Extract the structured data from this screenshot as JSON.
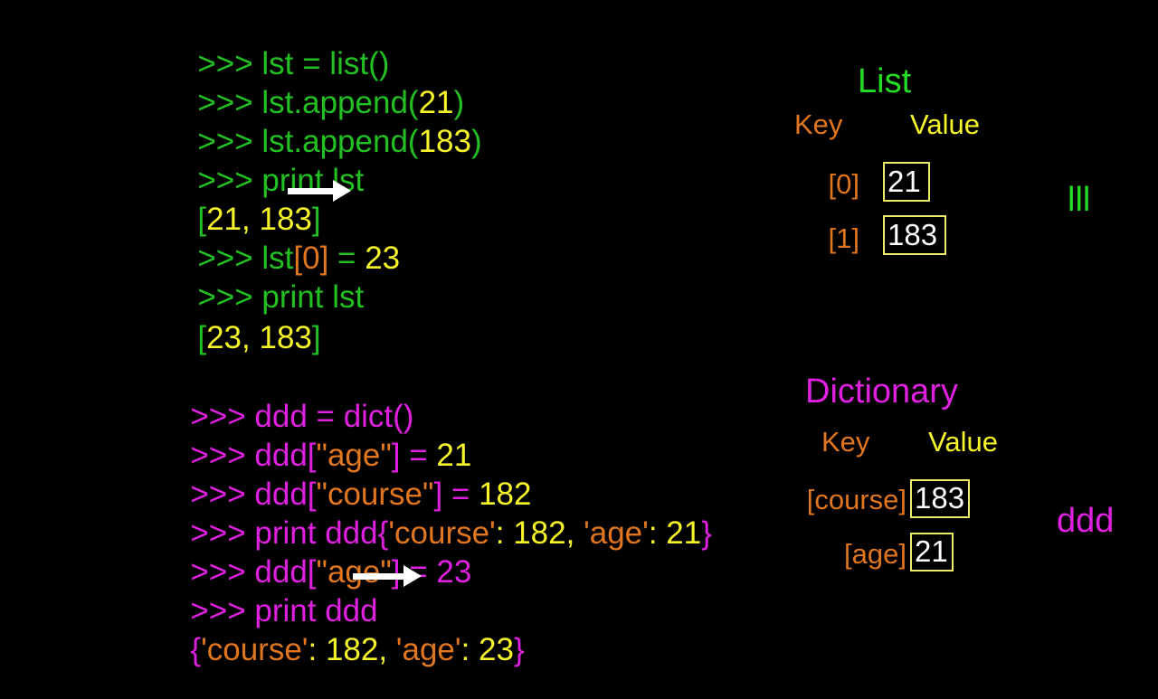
{
  "slide": {
    "background_color": "#000000",
    "colors": {
      "green": "#22c022",
      "green_bright": "#22dd22",
      "yellow": "#f5f52a",
      "orange": "#e0761f",
      "magenta": "#e020e0",
      "white": "#ffffff",
      "box_border": "#eeee66"
    }
  },
  "list_console": {
    "lines": [
      {
        "prompt": ">>> ",
        "code": "lst = list()",
        "number": ""
      },
      {
        "prompt": ">>> ",
        "code": "lst.append(",
        "number": "21",
        "close": ")"
      },
      {
        "prompt": ">>> ",
        "code": "lst.append(",
        "number": "183",
        "close": ")"
      },
      {
        "prompt": ">>> ",
        "code": "print lst",
        "number": ""
      },
      {
        "output_open": "[",
        "out_a": "21",
        "out_sep": ", ",
        "out_b": "183",
        "output_close": "]"
      },
      {
        "prompt": ">>> ",
        "code": "lst",
        "index": "[0]",
        "eq": " = ",
        "number": "23"
      },
      {
        "prompt": ">>> ",
        "code": "print lst",
        "number": ""
      },
      {
        "output_open": "[",
        "out_a": "23",
        "out_sep": ", ",
        "out_b": "183",
        "output_close": "]"
      }
    ],
    "l1_prompt": ">>> ",
    "l1_code": "lst = list()",
    "l2_prompt": ">>> ",
    "l2_code": "lst.append(",
    "l2_num": "21",
    "l2_close": ")",
    "l3_prompt": ">>> ",
    "l3_code": "lst.append(",
    "l3_num": "183",
    "l3_close": ")",
    "l4_prompt": ">>> ",
    "l4_code": "print lst",
    "l5_open": "[",
    "l5_a": "21",
    "l5_sep": ", ",
    "l5_b": "183",
    "l5_close": "]",
    "l6_prompt": ">>> ",
    "l6_code": "lst",
    "l6_index": "[0]",
    "l6_eq": " = ",
    "l6_num": "23",
    "l7_prompt": ">>> ",
    "l7_code": "print lst",
    "l8_open": "[",
    "l8_a": "23",
    "l8_sep": ", ",
    "l8_b": "183",
    "l8_close": "]"
  },
  "dict_console": {
    "d1_prompt": ">>> ",
    "d1_code": "ddd = dict()",
    "d2_prompt": ">>> ",
    "d2_code": "ddd[",
    "d2_key": "\"age\"",
    "d2_bracket": "]",
    "d2_eq": " = ",
    "d2_num": "21",
    "d3_prompt": ">>> ",
    "d3_code": "ddd[",
    "d3_key": "\"course\"",
    "d3_bracket": "]",
    "d3_eq": " = ",
    "d3_num": "182",
    "d4_prompt": ">>> ",
    "d4_code": "print ddd",
    "d4_open": "{",
    "d4_k1": "'course'",
    "d4_c1": ": ",
    "d4_v1": "182",
    "d4_sep": ", ",
    "d4_k2": "'age'",
    "d4_c2": ": ",
    "d4_v2": "21",
    "d4_close": "}",
    "d5_prompt": ">>> ",
    "d5_code": "ddd[",
    "d5_key": "\"age\"",
    "d5_bracket": "]",
    "d5_eq": " = ",
    "d5_num": "23",
    "d6_prompt": ">>> ",
    "d6_code": "print ddd",
    "d7_open": "{",
    "d7_k1": "'course'",
    "d7_c1": ": ",
    "d7_v1": "182",
    "d7_sep": ", ",
    "d7_k2": "'age'",
    "d7_c2": ": ",
    "d7_v2": "23",
    "d7_close": "}"
  },
  "list_panel": {
    "title": "List",
    "key_header": "Key",
    "value_header": "Value",
    "rows": [
      {
        "key": "[0]",
        "value": "21"
      },
      {
        "key": "[1]",
        "value": "183"
      }
    ],
    "row0_key": "[0]",
    "row0_value": "21",
    "row1_key": "[1]",
    "row1_value": "183",
    "variable_label": "lll"
  },
  "dict_panel": {
    "title": "Dictionary",
    "key_header": "Key",
    "value_header": "Value",
    "rows": [
      {
        "key": "[course]",
        "value": "183"
      },
      {
        "key": "[age]",
        "value": "21"
      }
    ],
    "row0_key": "[course]",
    "row0_value": "183",
    "row1_key": "[age]",
    "row1_value": "21",
    "variable_label": "ddd"
  }
}
